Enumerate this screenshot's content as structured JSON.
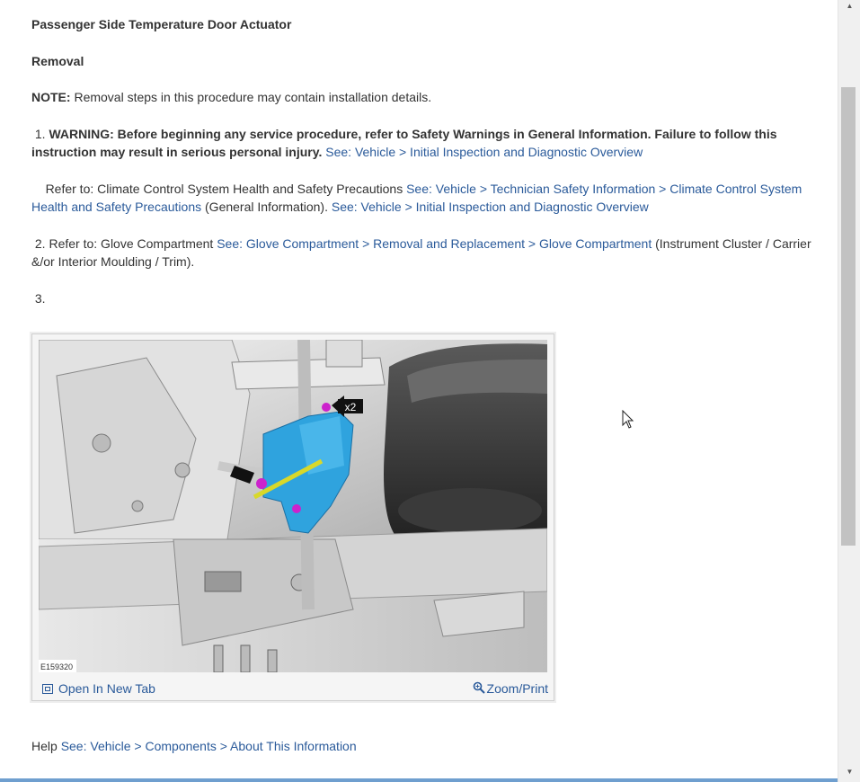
{
  "title": "Passenger Side Temperature Door Actuator",
  "section": "Removal",
  "note": {
    "label": "NOTE:",
    "text": " Removal steps in this procedure may contain installation details."
  },
  "step1": {
    "num": "1.",
    "warning": "WARNING: Before beginning any service procedure, refer to Safety Warnings in General Information. Failure to follow this instruction may result in serious personal injury.",
    "link1": "See: Vehicle > Initial Inspection and Diagnostic Overview",
    "refer_prefix": "Refer to: Climate Control System Health and Safety Precautions",
    "link2": "See: Vehicle > Technician Safety Information > Climate Control System Health and Safety Precautions",
    "gen_info": " (General Information). ",
    "link3": "See: Vehicle > Initial Inspection and Diagnostic Overview"
  },
  "step2": {
    "num": "2.",
    "prefix": "Refer to: Glove Compartment",
    "link": "See: Glove Compartment > Removal and Replacement > Glove Compartment",
    "suffix": " (Instrument Cluster / Carrier &/or Interior Moulding / Trim)."
  },
  "step3": {
    "num": "3."
  },
  "figure": {
    "image_id": "E159320",
    "callout": "x2",
    "open_tab": "Open In New Tab",
    "zoom": "Zoom/Print"
  },
  "help": {
    "prefix": "Help",
    "link": "See: Vehicle > Components > About This Information"
  },
  "colors": {
    "link": "#2a5a9a",
    "text": "#333333",
    "actuator": "#2fa3de",
    "fastener": "#cc22cc",
    "lever": "#d8d82a"
  },
  "icons": [
    "open-tab-icon",
    "zoom-icon",
    "arrow-cursor-icon"
  ]
}
